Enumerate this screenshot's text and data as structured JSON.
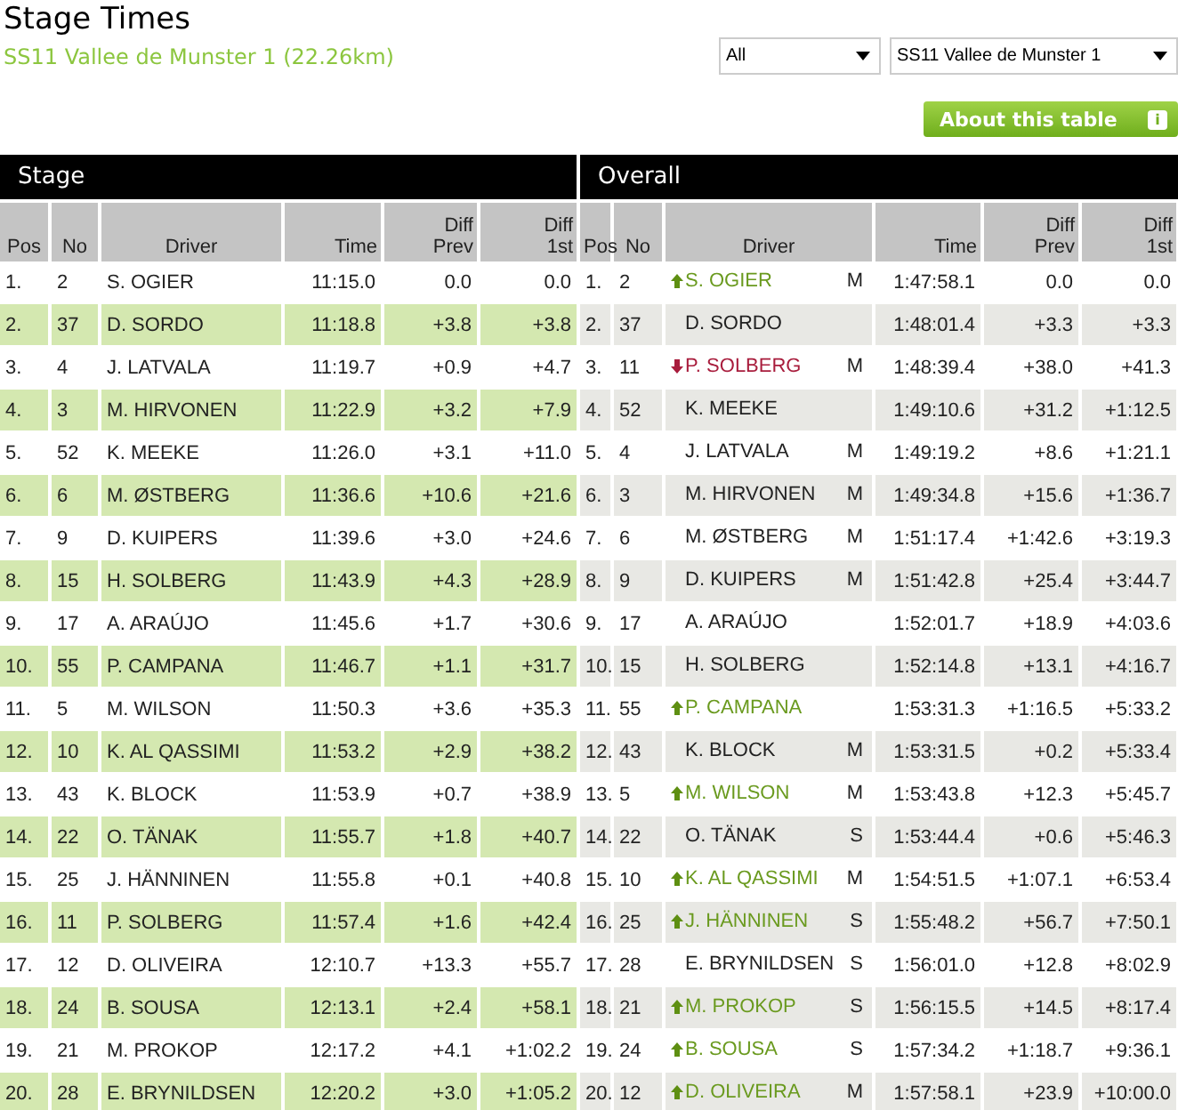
{
  "title": "Stage Times",
  "subtitle": "SS11 Vallee de Munster 1 (22.26km)",
  "filters": [
    {
      "value": "All"
    },
    {
      "value": "SS11 Vallee de Munster 1"
    }
  ],
  "about_button": {
    "label": "About this table",
    "icon": "i"
  },
  "sections": [
    "Stage",
    "Overall"
  ],
  "stage_columns": [
    "Pos",
    "No",
    "Driver",
    "Time",
    "Diff\nPrev",
    "Diff\n1st"
  ],
  "overall_columns": [
    "Pos",
    "No",
    "Driver",
    "Time",
    "Diff\nPrev",
    "Diff\n1st"
  ],
  "rows": [
    {
      "stage": [
        "1.",
        "2",
        "S. OGIER",
        "11:15.0",
        "0.0",
        "0.0"
      ],
      "overall": {
        "cells": [
          "1.",
          "2",
          "S. OGIER",
          "1:47:58.1",
          "0.0",
          "0.0"
        ],
        "kind": "up",
        "tyre": "M"
      }
    },
    {
      "stage": [
        "2.",
        "37",
        "D. SORDO",
        "11:18.8",
        "+3.8",
        "+3.8"
      ],
      "overall": {
        "cells": [
          "2.",
          "37",
          "D. SORDO",
          "1:48:01.4",
          "+3.3",
          "+3.3"
        ],
        "kind": "same"
      }
    },
    {
      "stage": [
        "3.",
        "4",
        "J. LATVALA",
        "11:19.7",
        "+0.9",
        "+4.7"
      ],
      "overall": {
        "cells": [
          "3.",
          "11",
          "P. SOLBERG",
          "1:48:39.4",
          "+38.0",
          "+41.3"
        ],
        "kind": "down",
        "tyre": "M"
      }
    },
    {
      "stage": [
        "4.",
        "3",
        "M. HIRVONEN",
        "11:22.9",
        "+3.2",
        "+7.9"
      ],
      "overall": {
        "cells": [
          "4.",
          "52",
          "K. MEEKE",
          "1:49:10.6",
          "+31.2",
          "+1:12.5"
        ],
        "kind": "same"
      }
    },
    {
      "stage": [
        "5.",
        "52",
        "K. MEEKE",
        "11:26.0",
        "+3.1",
        "+11.0"
      ],
      "overall": {
        "cells": [
          "5.",
          "4",
          "J. LATVALA",
          "1:49:19.2",
          "+8.6",
          "+1:21.1"
        ],
        "kind": "same",
        "tyre": "M"
      }
    },
    {
      "stage": [
        "6.",
        "6",
        "M. ØSTBERG",
        "11:36.6",
        "+10.6",
        "+21.6"
      ],
      "overall": {
        "cells": [
          "6.",
          "3",
          "M. HIRVONEN",
          "1:49:34.8",
          "+15.6",
          "+1:36.7"
        ],
        "kind": "same",
        "tyre": "M"
      }
    },
    {
      "stage": [
        "7.",
        "9",
        "D. KUIPERS",
        "11:39.6",
        "+3.0",
        "+24.6"
      ],
      "overall": {
        "cells": [
          "7.",
          "6",
          "M. ØSTBERG",
          "1:51:17.4",
          "+1:42.6",
          "+3:19.3"
        ],
        "kind": "same",
        "tyre": "M"
      }
    },
    {
      "stage": [
        "8.",
        "15",
        "H. SOLBERG",
        "11:43.9",
        "+4.3",
        "+28.9"
      ],
      "overall": {
        "cells": [
          "8.",
          "9",
          "D. KUIPERS",
          "1:51:42.8",
          "+25.4",
          "+3:44.7"
        ],
        "kind": "same",
        "tyre": "M"
      }
    },
    {
      "stage": [
        "9.",
        "17",
        "A. ARAÚJO",
        "11:45.6",
        "+1.7",
        "+30.6"
      ],
      "overall": {
        "cells": [
          "9.",
          "17",
          "A. ARAÚJO",
          "1:52:01.7",
          "+18.9",
          "+4:03.6"
        ],
        "kind": "same"
      }
    },
    {
      "stage": [
        "10.",
        "55",
        "P. CAMPANA",
        "11:46.7",
        "+1.1",
        "+31.7"
      ],
      "overall": {
        "cells": [
          "10.",
          "15",
          "H. SOLBERG",
          "1:52:14.8",
          "+13.1",
          "+4:16.7"
        ],
        "kind": "same"
      }
    },
    {
      "stage": [
        "11.",
        "5",
        "M. WILSON",
        "11:50.3",
        "+3.6",
        "+35.3"
      ],
      "overall": {
        "cells": [
          "11.",
          "55",
          "P. CAMPANA",
          "1:53:31.3",
          "+1:16.5",
          "+5:33.2"
        ],
        "kind": "up"
      }
    },
    {
      "stage": [
        "12.",
        "10",
        "K. AL QASSIMI",
        "11:53.2",
        "+2.9",
        "+38.2"
      ],
      "overall": {
        "cells": [
          "12.",
          "43",
          "K. BLOCK",
          "1:53:31.5",
          "+0.2",
          "+5:33.4"
        ],
        "kind": "same",
        "tyre": "M"
      }
    },
    {
      "stage": [
        "13.",
        "43",
        "K. BLOCK",
        "11:53.9",
        "+0.7",
        "+38.9"
      ],
      "overall": {
        "cells": [
          "13.",
          "5",
          "M. WILSON",
          "1:53:43.8",
          "+12.3",
          "+5:45.7"
        ],
        "kind": "up",
        "tyre": "M"
      }
    },
    {
      "stage": [
        "14.",
        "22",
        "O. TÄNAK",
        "11:55.7",
        "+1.8",
        "+40.7"
      ],
      "overall": {
        "cells": [
          "14.",
          "22",
          "O. TÄNAK",
          "1:53:44.4",
          "+0.6",
          "+5:46.3"
        ],
        "kind": "same",
        "tyre": "S"
      }
    },
    {
      "stage": [
        "15.",
        "25",
        "J. HÄNNINEN",
        "11:55.8",
        "+0.1",
        "+40.8"
      ],
      "overall": {
        "cells": [
          "15.",
          "10",
          "K. AL QASSIMI",
          "1:54:51.5",
          "+1:07.1",
          "+6:53.4"
        ],
        "kind": "up",
        "tyre": "M"
      }
    },
    {
      "stage": [
        "16.",
        "11",
        "P. SOLBERG",
        "11:57.4",
        "+1.6",
        "+42.4"
      ],
      "overall": {
        "cells": [
          "16.",
          "25",
          "J. HÄNNINEN",
          "1:55:48.2",
          "+56.7",
          "+7:50.1"
        ],
        "kind": "up",
        "tyre": "S"
      }
    },
    {
      "stage": [
        "17.",
        "12",
        "D. OLIVEIRA",
        "12:10.7",
        "+13.3",
        "+55.7"
      ],
      "overall": {
        "cells": [
          "17.",
          "28",
          "E. BRYNILDSEN",
          "1:56:01.0",
          "+12.8",
          "+8:02.9"
        ],
        "kind": "same",
        "tyre": "S"
      }
    },
    {
      "stage": [
        "18.",
        "24",
        "B. SOUSA",
        "12:13.1",
        "+2.4",
        "+58.1"
      ],
      "overall": {
        "cells": [
          "18.",
          "21",
          "M. PROKOP",
          "1:56:15.5",
          "+14.5",
          "+8:17.4"
        ],
        "kind": "up",
        "tyre": "S"
      }
    },
    {
      "stage": [
        "19.",
        "21",
        "M. PROKOP",
        "12:17.2",
        "+4.1",
        "+1:02.2"
      ],
      "overall": {
        "cells": [
          "19.",
          "24",
          "B. SOUSA",
          "1:57:34.2",
          "+1:18.7",
          "+9:36.1"
        ],
        "kind": "up",
        "tyre": "S"
      }
    },
    {
      "stage": [
        "20.",
        "28",
        "E. BRYNILDSEN",
        "12:20.2",
        "+3.0",
        "+1:05.2"
      ],
      "overall": {
        "cells": [
          "20.",
          "12",
          "D. OLIVEIRA",
          "1:57:58.1",
          "+23.9",
          "+10:00.0"
        ],
        "kind": "up",
        "tyre": "M"
      }
    }
  ]
}
